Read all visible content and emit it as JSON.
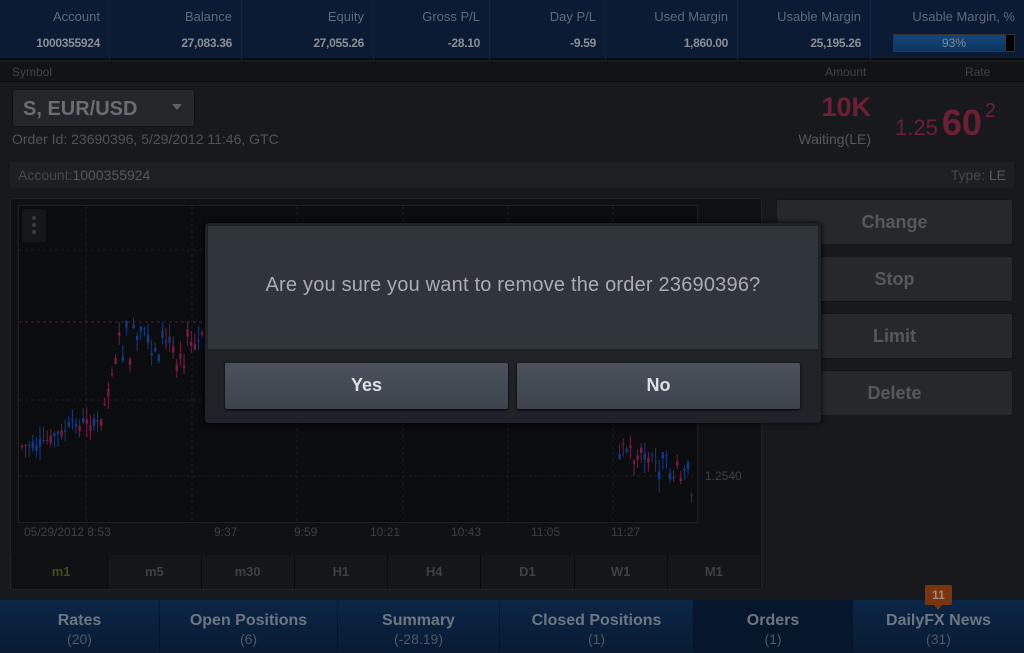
{
  "account_bar": [
    {
      "label": "Account",
      "value": "1000355924"
    },
    {
      "label": "Balance",
      "value": "27,083.36"
    },
    {
      "label": "Equity",
      "value": "27,055.26"
    },
    {
      "label": "Gross P/L",
      "value": "-28.10"
    },
    {
      "label": "Day P/L",
      "value": "-9.59"
    },
    {
      "label": "Used Margin",
      "value": "1,860.00"
    },
    {
      "label": "Usable Margin",
      "value": "25,195.26"
    },
    {
      "label": "Usable Margin, %",
      "value": "93%",
      "percent": 93
    }
  ],
  "header": {
    "symbol": "Symbol",
    "amount": "Amount",
    "rate": "Rate"
  },
  "order": {
    "symbol": "S, EUR/USD",
    "info": "Order Id: 23690396,  5/29/2012 11:46, GTC",
    "amount": "10K",
    "status": "Waiting(LE)",
    "rate_prefix": "1.25",
    "rate_big": "60",
    "rate_sup": "2",
    "account_label": "Account:",
    "account_value": "1000355924",
    "type_label": "Type:",
    "type_value": "LE"
  },
  "chart": {
    "x_labels": [
      "05/29/2012 8:53",
      "9:37",
      "9:59",
      "10:21",
      "10:43",
      "11:05",
      "11:27"
    ],
    "y_label": "1.2540",
    "timeframes": [
      "m1",
      "m5",
      "m30",
      "H1",
      "H4",
      "D1",
      "W1",
      "M1"
    ],
    "active_timeframe": "m1",
    "up_color": "#0e3a8a",
    "down_color": "#7a1a45"
  },
  "actions": [
    "Change",
    "Stop",
    "Limit",
    "Delete"
  ],
  "dialog": {
    "message": "Are you sure you want to remove the order 23690396?",
    "yes": "Yes",
    "no": "No"
  },
  "bottom_tabs": [
    {
      "name": "Rates",
      "count": "(20)"
    },
    {
      "name": "Open Positions",
      "count": "(6)"
    },
    {
      "name": "Summary",
      "count": "(-28.19)"
    },
    {
      "name": "Closed Positions",
      "count": "(1)"
    },
    {
      "name": "Orders",
      "count": "(1)",
      "active": true
    },
    {
      "name": "DailyFX News",
      "count": "(31)",
      "badge": "11"
    }
  ]
}
